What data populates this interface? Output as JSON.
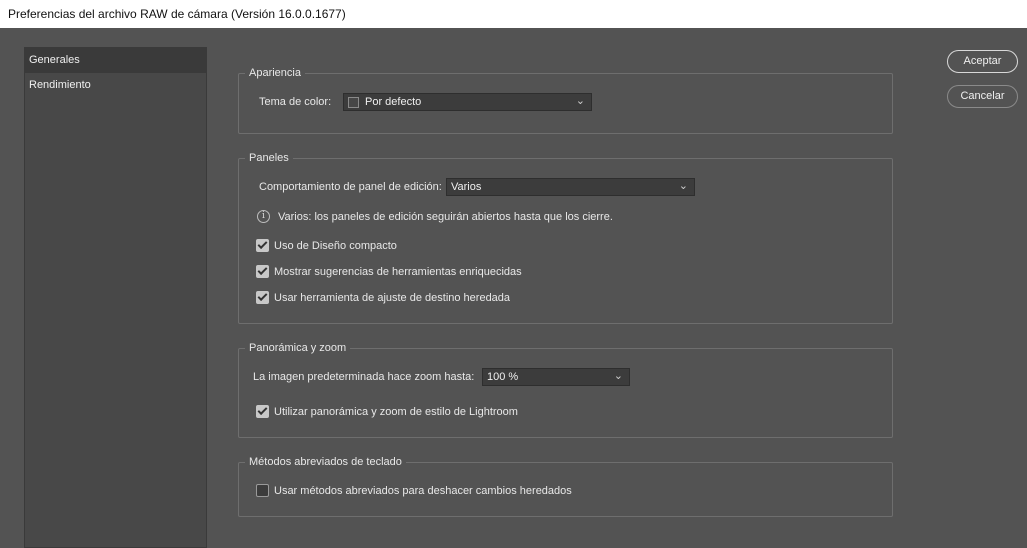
{
  "window": {
    "title": "Preferencias del archivo RAW de cámara  (Versión 16.0.0.1677)"
  },
  "sidebar": {
    "items": [
      {
        "label": "Generales",
        "active": true
      },
      {
        "label": "Rendimiento",
        "active": false
      }
    ]
  },
  "buttons": {
    "accept": "Aceptar",
    "cancel": "Cancelar"
  },
  "appearance": {
    "legend": "Apariencia",
    "theme_label": "Tema de color:",
    "theme_value": "Por defecto"
  },
  "panels": {
    "legend": "Paneles",
    "behavior_label": "Comportamiento de panel de edición:",
    "behavior_value": "Varios",
    "info_text": "Varios: los paneles de edición seguirán abiertos hasta que los cierre.",
    "options": [
      {
        "label": "Uso de Diseño compacto",
        "checked": true
      },
      {
        "label": "Mostrar sugerencias de herramientas enriquecidas",
        "checked": true
      },
      {
        "label": "Usar herramienta de ajuste de destino heredada",
        "checked": true
      }
    ]
  },
  "panzoom": {
    "legend": "Panorámica y zoom",
    "zoom_label": "La imagen predeterminada hace zoom hasta:",
    "zoom_value": "100 %",
    "lightroom_label": "Utilizar panorámica y zoom de estilo de Lightroom",
    "lightroom_checked": true
  },
  "shortcuts": {
    "legend": "Métodos abreviados de teclado",
    "legacy_label": "Usar métodos abreviados para deshacer cambios heredados",
    "legacy_checked": false
  },
  "icons": {
    "chevron": "chevron-down-icon",
    "info": "info-icon",
    "swatch": "color-swatch-icon"
  }
}
